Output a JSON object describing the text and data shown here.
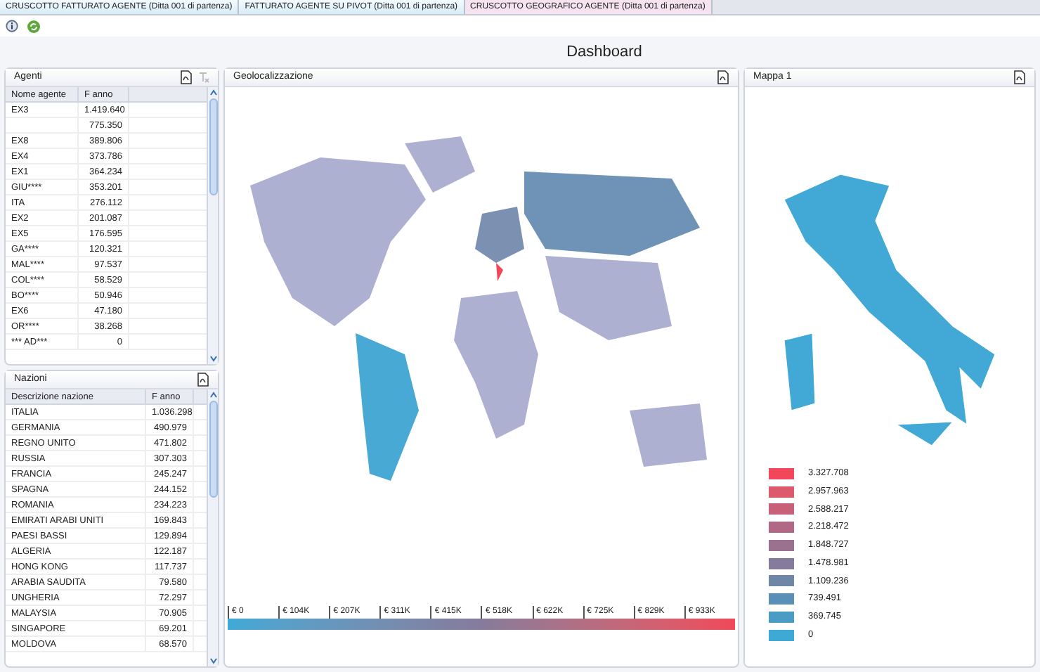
{
  "tabs": [
    {
      "label": "CRUSCOTTO FATTURATO AGENTE (Ditta 001 di partenza)",
      "selected": false
    },
    {
      "label": "FATTURATO AGENTE SU PIVOT (Ditta 001 di partenza)",
      "selected": false
    },
    {
      "label": "CRUSCOTTO GEOGRAFICO AGENTE (Ditta 001 di partenza)",
      "selected": true
    }
  ],
  "title": "Dashboard",
  "agents": {
    "title": "Agenti",
    "columns": [
      "Nome agente",
      "F anno"
    ],
    "rows": [
      [
        "EX3",
        "1.419.640"
      ],
      [
        "",
        "775.350"
      ],
      [
        "EX8",
        "389.806"
      ],
      [
        "EX4",
        "373.786"
      ],
      [
        "EX1",
        "364.234"
      ],
      [
        "GIU****",
        "353.201"
      ],
      [
        "ITA",
        "276.112"
      ],
      [
        "EX2",
        "201.087"
      ],
      [
        "EX5",
        "176.595"
      ],
      [
        "GA****",
        "120.321"
      ],
      [
        "MAL****",
        "97.537"
      ],
      [
        "COL****",
        "58.529"
      ],
      [
        "BO****",
        "50.946"
      ],
      [
        "EX6",
        "47.180"
      ],
      [
        "OR****",
        "38.268"
      ],
      [
        "*** AD***",
        "0"
      ]
    ]
  },
  "nations": {
    "title": "Nazioni",
    "columns": [
      "Descrizione nazione",
      "F anno"
    ],
    "rows": [
      [
        "ITALIA",
        "1.036.298"
      ],
      [
        "GERMANIA",
        "490.979"
      ],
      [
        "REGNO UNITO",
        "471.802"
      ],
      [
        "RUSSIA",
        "307.303"
      ],
      [
        "FRANCIA",
        "245.247"
      ],
      [
        "SPAGNA",
        "244.152"
      ],
      [
        "ROMANIA",
        "234.223"
      ],
      [
        "EMIRATI ARABI UNITI",
        "169.843"
      ],
      [
        "PAESI BASSI",
        "129.894"
      ],
      [
        "ALGERIA",
        "122.187"
      ],
      [
        "HONG KONG",
        "117.737"
      ],
      [
        "ARABIA SAUDITA",
        "79.580"
      ],
      [
        "UNGHERIA",
        "72.297"
      ],
      [
        "MALAYSIA",
        "70.905"
      ],
      [
        "SINGAPORE",
        "69.201"
      ],
      [
        "MOLDOVA",
        "68.570"
      ]
    ]
  },
  "geo": {
    "title": "Geolocalizzazione",
    "scale_ticks": [
      "€ 0",
      "€ 104K",
      "€ 207K",
      "€ 311K",
      "€ 415K",
      "€ 518K",
      "€ 622K",
      "€ 725K",
      "€ 829K",
      "€ 933K"
    ]
  },
  "map": {
    "title": "Mappa 1",
    "legend": [
      {
        "label": "3.327.708",
        "color": "#f0485a"
      },
      {
        "label": "2.957.963",
        "color": "#dd5a6c"
      },
      {
        "label": "2.588.217",
        "color": "#c9607a"
      },
      {
        "label": "2.218.472",
        "color": "#b06884"
      },
      {
        "label": "1.848.727",
        "color": "#9a718e"
      },
      {
        "label": "1.478.981",
        "color": "#857b9b"
      },
      {
        "label": "1.109.236",
        "color": "#6f86a6"
      },
      {
        "label": "739.491",
        "color": "#5a90b6"
      },
      {
        "label": "369.745",
        "color": "#4a9cc5"
      },
      {
        "label": "0",
        "color": "#3fa9d6"
      }
    ]
  }
}
